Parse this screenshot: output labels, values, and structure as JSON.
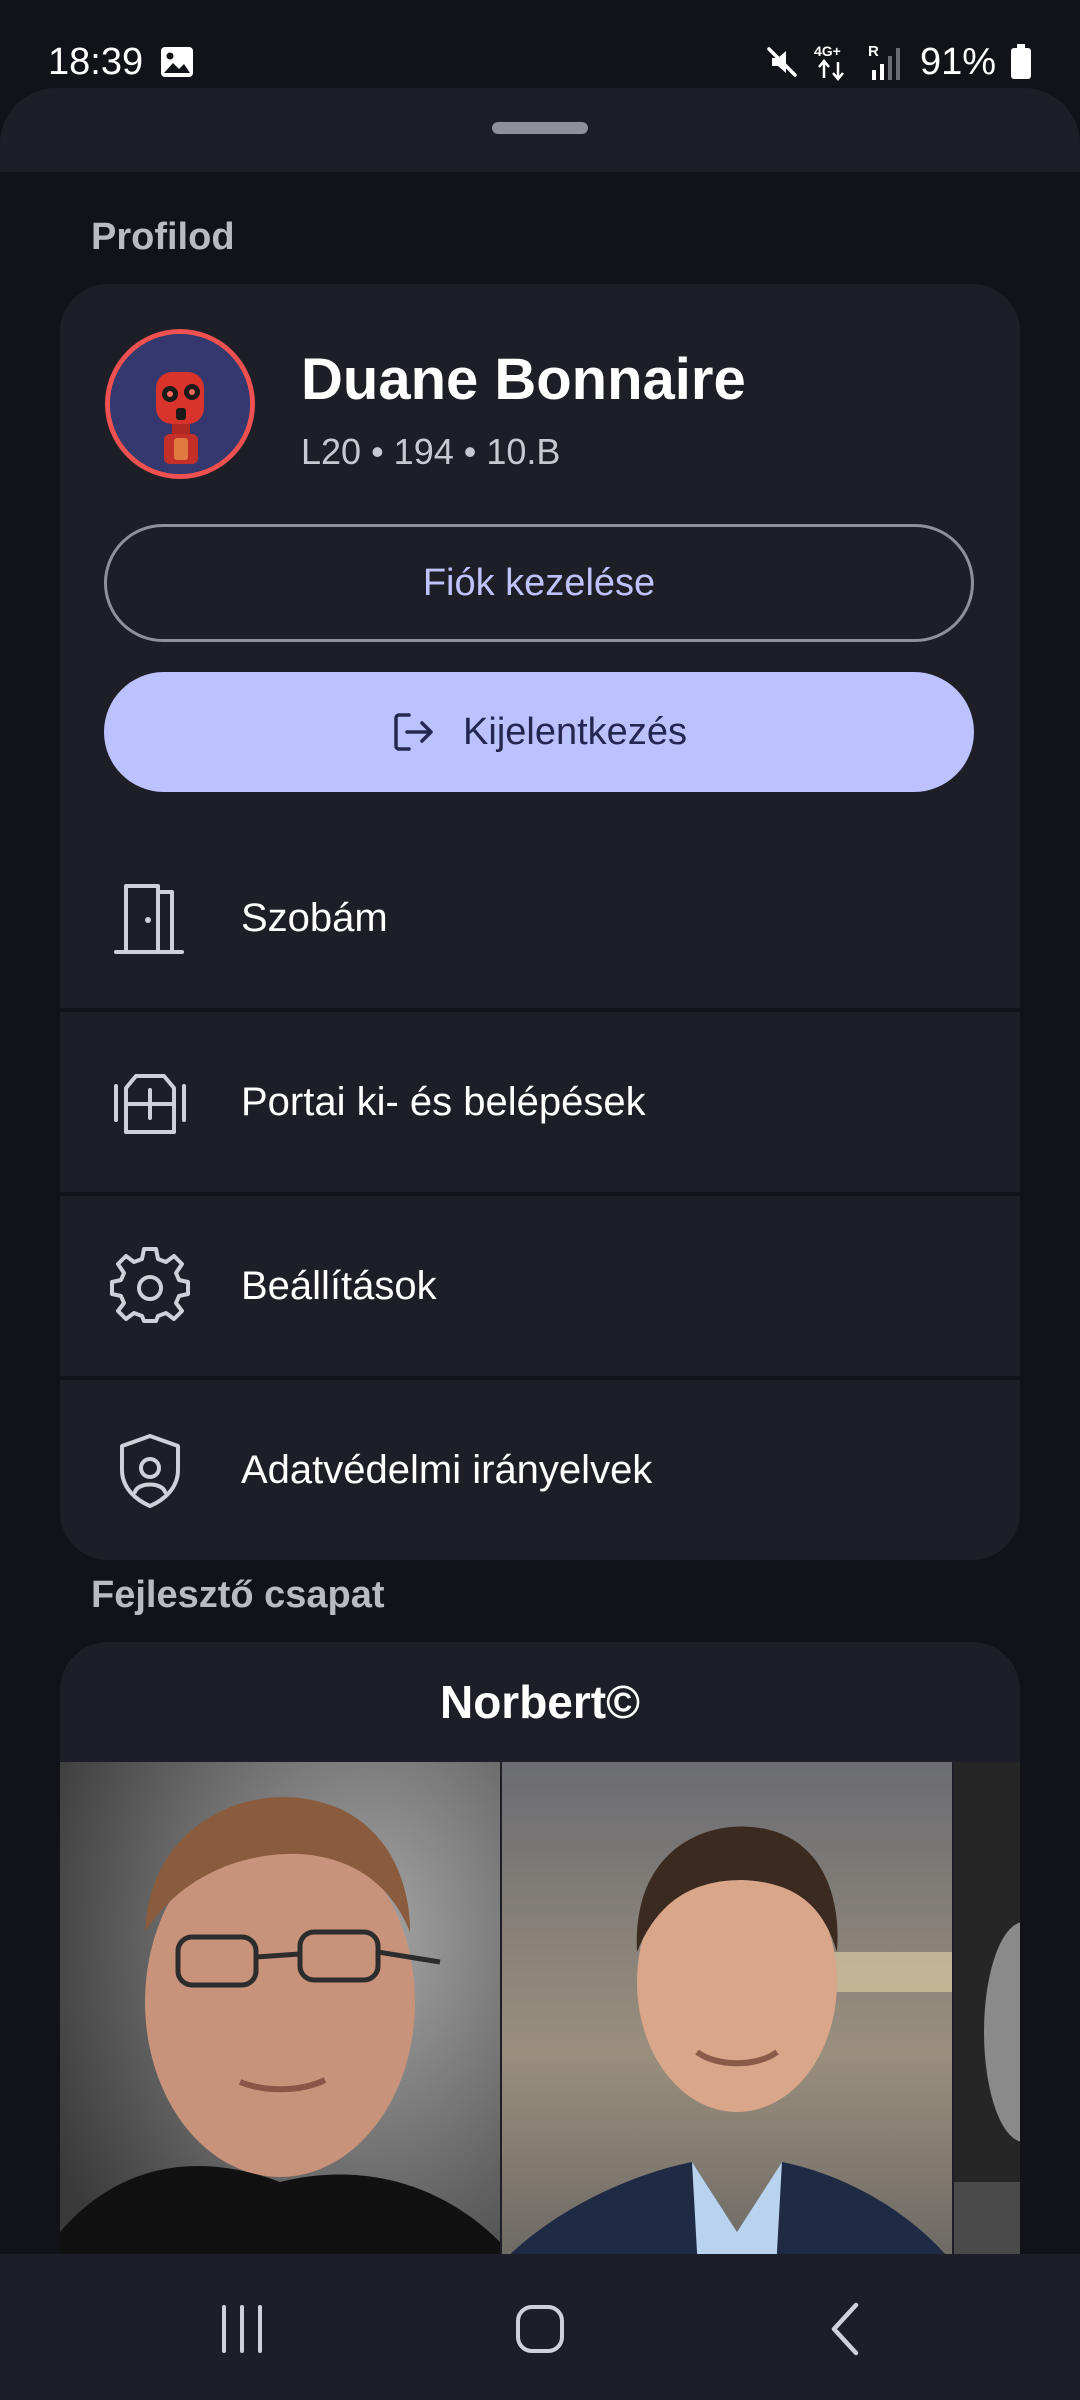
{
  "status_bar": {
    "time": "18:39",
    "battery": "91%",
    "network": "4G+",
    "roaming": "R"
  },
  "profile": {
    "section_title": "Profilod",
    "name": "Duane Bonnaire",
    "meta": "L20 • 194 • 10.B",
    "manage_account_label": "Fiók kezelése",
    "logout_label": "Kijelentkezés"
  },
  "menu": {
    "items": [
      {
        "label": "Szobám",
        "icon": "door-icon"
      },
      {
        "label": "Portai ki- és belépések",
        "icon": "entry-exit-icon"
      },
      {
        "label": "Beállítások",
        "icon": "gear-icon"
      },
      {
        "label": "Adatvédelmi irányelvek",
        "icon": "privacy-shield-icon"
      }
    ]
  },
  "team": {
    "section_title": "Fejlesztő csapat",
    "member_name": "Norbert©"
  },
  "colors": {
    "background": "#121318",
    "surface": "#1e1f26",
    "primary": "#bcc2ff",
    "on_primary": "#242850",
    "avatar_ring": "#ef5050"
  }
}
